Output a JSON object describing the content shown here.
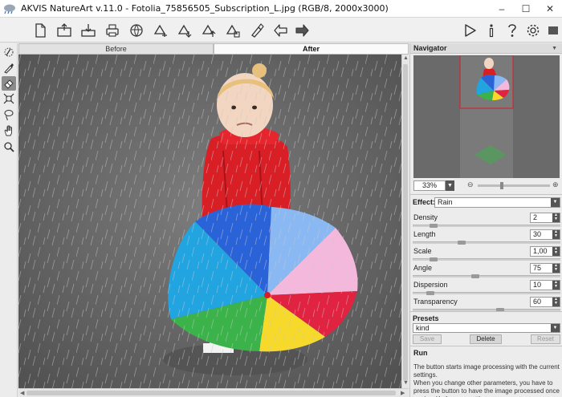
{
  "window": {
    "title": "AKVIS NatureArt v.11.0 - Fotolia_75856505_Subscription_L.jpg (RGB/8, 2000x3000)",
    "minimize": "–",
    "maximize": "☐",
    "close": "✕"
  },
  "toolbar": {
    "left_icons": [
      "new-file-icon",
      "open-image-icon",
      "save-image-icon",
      "print-icon",
      "share-icon",
      "batch-icon",
      "import-icon",
      "export-icon",
      "snapshot-icon",
      "brush-icon",
      "undo-arrow-icon",
      "redo-arrow-icon"
    ],
    "right_icons": [
      "run-icon",
      "info-icon",
      "help-icon",
      "settings-icon",
      "panel-icon"
    ]
  },
  "tools": [
    "rain-drops-tool-icon",
    "brush-tool-icon",
    "eraser-tool-icon",
    "crop-tool-icon",
    "lasso-tool-icon",
    "hand-tool-icon",
    "zoom-tool-icon"
  ],
  "tabs": {
    "before": "Before",
    "after": "After"
  },
  "navigator": {
    "title": "Navigator",
    "zoom": "33%",
    "zoom_level": 0.32,
    "minus": "⊖",
    "plus": "⊕"
  },
  "effect": {
    "label": "Effect:",
    "value": "Rain"
  },
  "params": [
    {
      "label": "Density",
      "value": "2",
      "level": 0.12
    },
    {
      "label": "Length",
      "value": "30",
      "level": 0.32
    },
    {
      "label": "Scale",
      "value": "1,00",
      "level": 0.12
    },
    {
      "label": "Angle",
      "value": "75",
      "level": 0.42
    },
    {
      "label": "Dispersion",
      "value": "10",
      "level": 0.1
    },
    {
      "label": "Transparency",
      "value": "60",
      "level": 0.6
    }
  ],
  "presets": {
    "title": "Presets",
    "value": "kind",
    "save": "Save",
    "delete": "Delete",
    "reset": "Reset"
  },
  "help": {
    "title": "Run",
    "text": "The button starts image processing with the current settings.\nWhen you change other parameters, you have to press the button to have the image processed once again with the new settings."
  },
  "colors": {
    "accent_red": "#d81f26",
    "umbrella": [
      "#2a62d8",
      "#8ab8f2",
      "#f5b8dd",
      "#e02340",
      "#f6d92b",
      "#3bb24a",
      "#21a4e0"
    ]
  }
}
